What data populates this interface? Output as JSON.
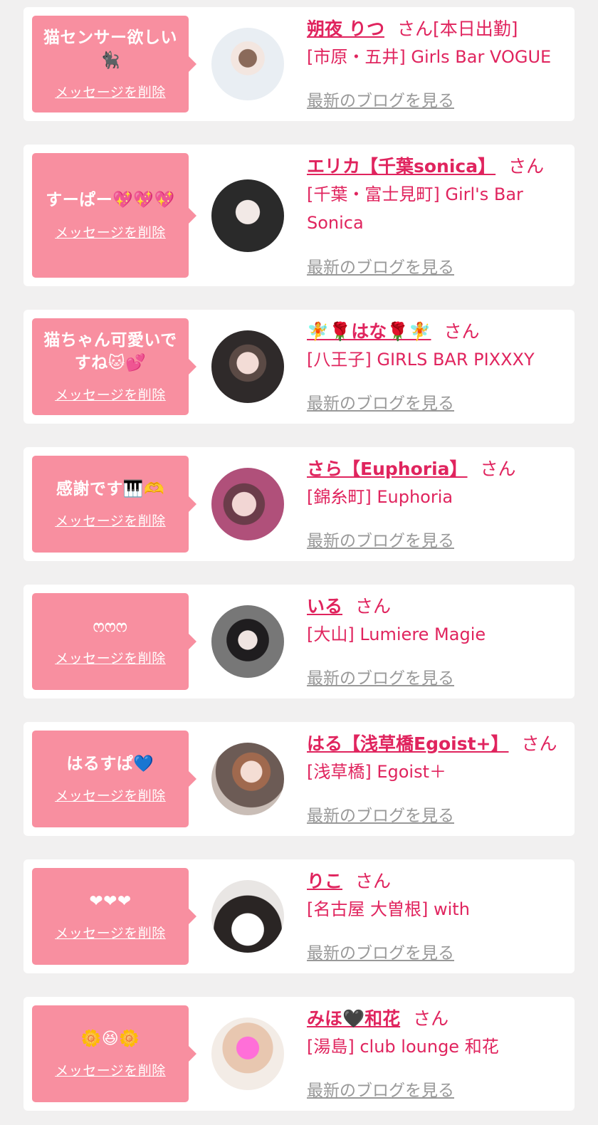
{
  "delete_label": "メッセージを削除",
  "blog_label": "最新のブログを見る",
  "san_label": "さん",
  "cards": [
    {
      "message": "猫センサー欲しい🐈‍⬛",
      "name": "朔夜 りつ",
      "san_suffix": "さん[本日出勤]",
      "shop": "[市原・五井] Girls Bar VOGUE"
    },
    {
      "message": "すーぱー💖💖💖",
      "name": "エリカ【千葉sonica】",
      "san_suffix": "さん",
      "shop": "[千葉・富士見町] Girl's Bar Sonica"
    },
    {
      "message": "猫ちゃん可愛いですね🐱💕",
      "name": "🧚🌹はな🌹🧚",
      "san_suffix": "さん",
      "shop": "[八王子] GIRLS BAR PIXXXY"
    },
    {
      "message": "感謝です🎹🫶",
      "name": "さら【Euphoria】",
      "san_suffix": "さん",
      "shop": "[錦糸町] Euphoria"
    },
    {
      "message": "ෆෆෆ",
      "name": "いる",
      "san_suffix": "さん",
      "shop": "[大山] Lumiere Magie"
    },
    {
      "message": "はるすぱ💙",
      "name": "はる【浅草橋Egoist+】",
      "san_suffix": "さん",
      "shop": "[浅草橋] Egoist＋"
    },
    {
      "message": "❤❤❤",
      "name": "りこ",
      "san_suffix": "さん",
      "shop": "[名古屋 大曽根] with"
    },
    {
      "message": "🌼😆🌼",
      "name": "みほ🖤和花",
      "san_suffix": "さん",
      "shop": "[湯島] club lounge 和花"
    }
  ]
}
